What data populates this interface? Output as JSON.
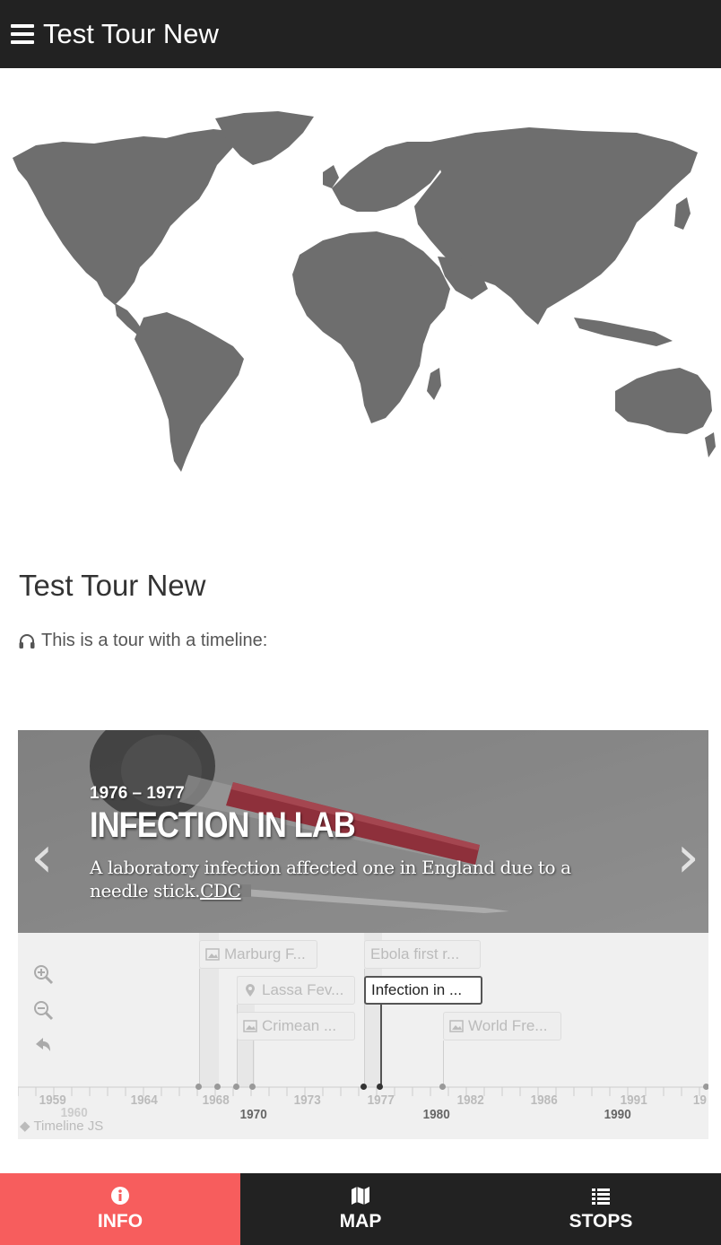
{
  "header": {
    "title": "Test Tour New"
  },
  "tour": {
    "title": "Test Tour New",
    "description": "This is a tour with a timeline:"
  },
  "timeline": {
    "slide": {
      "date": "1976 – 1977",
      "headline": "INFECTION IN LAB",
      "text": "A laboratory infection affected one in England due to a needle stick.",
      "link_text": "CDC"
    },
    "markers": [
      {
        "label": "Marburg F...",
        "icon": "image-icon"
      },
      {
        "label": "Lassa Fev...",
        "icon": "map-pin-icon"
      },
      {
        "label": "Crimean ...",
        "icon": "image-icon"
      },
      {
        "label": "Ebola first r...",
        "icon": "none"
      },
      {
        "label": "Infection in ...",
        "icon": "none"
      },
      {
        "label": "World Fre...",
        "icon": "image-icon"
      }
    ],
    "minor_ticks": [
      "1959",
      "1964",
      "1968",
      "1973",
      "1977",
      "1982",
      "1986",
      "1991",
      "19"
    ],
    "major_ticks": [
      "1970",
      "1980",
      "1990"
    ],
    "overlap_label": "1960",
    "credit": "Timeline JS"
  },
  "tabs": [
    {
      "label": "INFO",
      "icon": "info-icon",
      "active": true
    },
    {
      "label": "MAP",
      "icon": "map-icon",
      "active": false
    },
    {
      "label": "STOPS",
      "icon": "list-icon",
      "active": false
    }
  ],
  "colors": {
    "header_bg": "#222222",
    "accent": "#f75d5d",
    "map_fill": "#6e6e6e"
  }
}
